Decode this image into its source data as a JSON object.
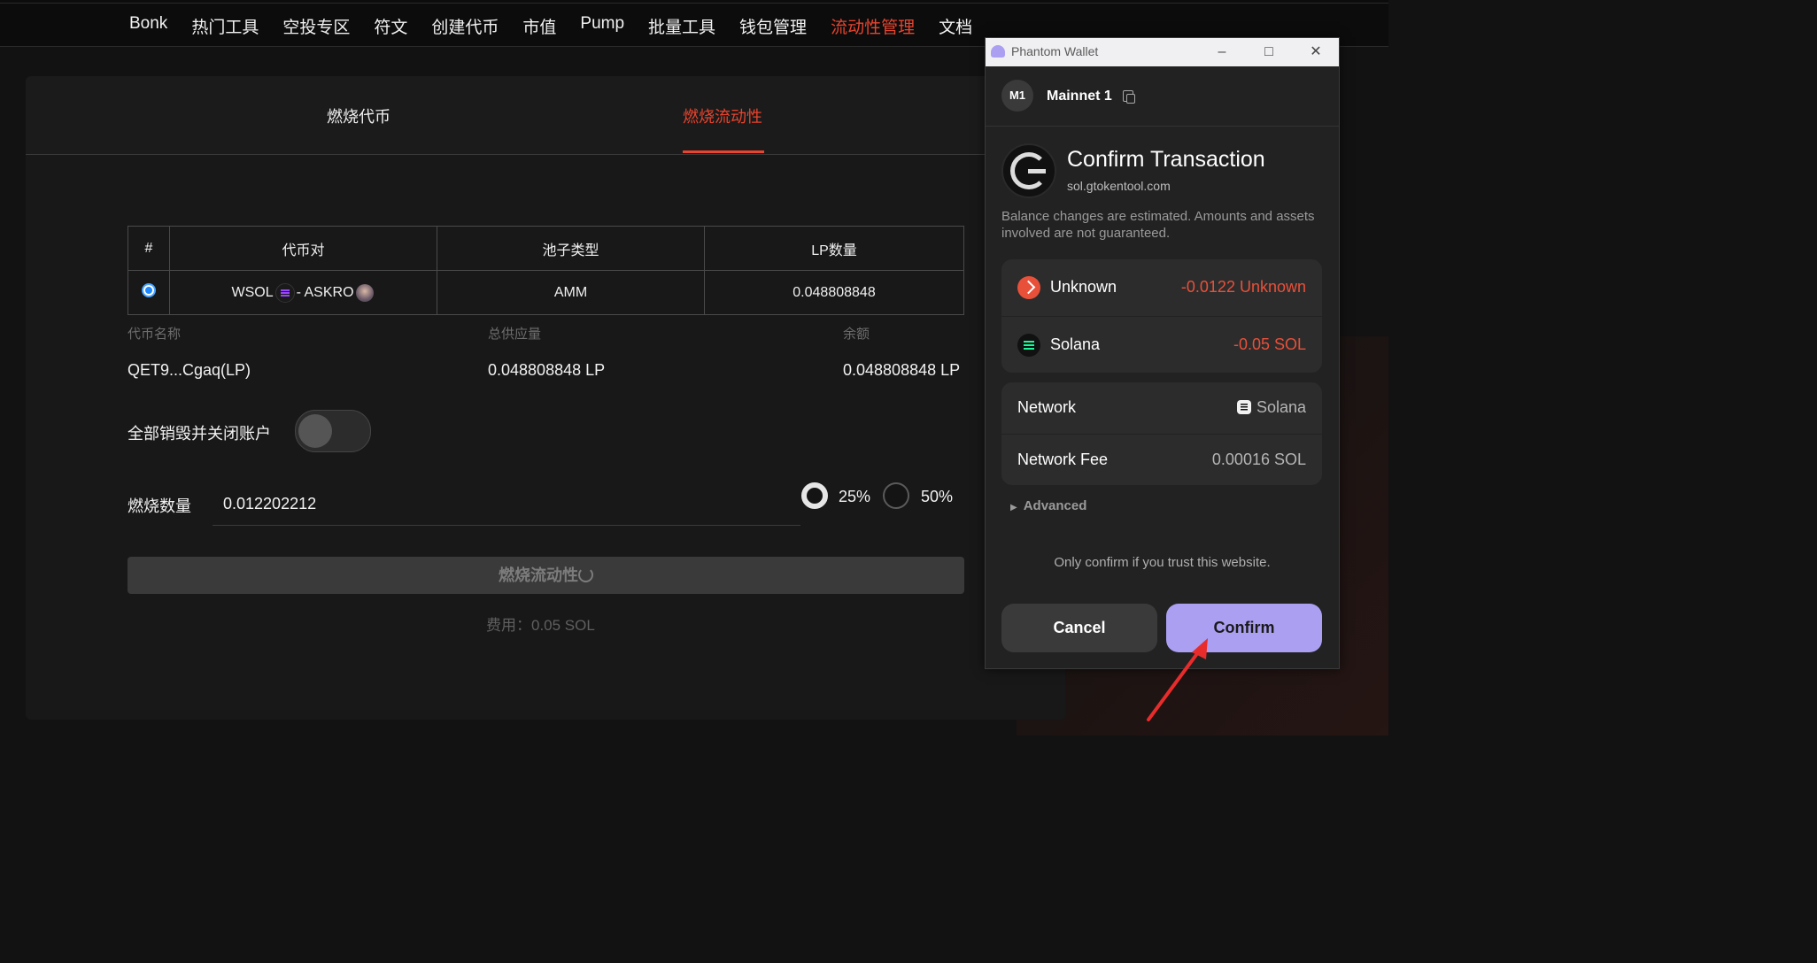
{
  "nav": {
    "items": [
      "Bonk",
      "热门工具",
      "空投专区",
      "符文",
      "创建代币",
      "市值",
      "Pump",
      "批量工具",
      "钱包管理",
      "流动性管理",
      "文档"
    ],
    "active_index": 9
  },
  "tabs": {
    "burn_token": "燃烧代币",
    "burn_liquidity": "燃烧流动性"
  },
  "pool_table": {
    "headers": [
      "#",
      "代币对",
      "池子类型",
      "LP数量"
    ],
    "row": {
      "pair_left": "WSOL",
      "pair_sep": "-",
      "pair_right": "ASKRO",
      "pool_type": "AMM",
      "lp_amount": "0.048808848"
    }
  },
  "token_info": {
    "name_label": "代币名称",
    "supply_label": "总供应量",
    "balance_label": "余额",
    "name_value": "QET9...Cgaq(LP)",
    "supply_value": "0.048808848 LP",
    "balance_value": "0.048808848 LP"
  },
  "close_all": {
    "label": "全部销毁并关闭账户",
    "enabled": false
  },
  "burn_amount": {
    "label": "燃烧数量",
    "value": "0.012202212"
  },
  "percent_options": [
    {
      "label": "25%",
      "selected": true
    },
    {
      "label": "50%",
      "selected": false
    }
  ],
  "burn_button": {
    "label": "燃烧流动性"
  },
  "fee_text": "费用：0.05 SOL",
  "popup": {
    "window_title": "Phantom Wallet",
    "account_badge": "M1",
    "account_name": "Mainnet 1",
    "title": "Confirm Transaction",
    "site": "sol.gtokentool.com",
    "warning": "Balance changes are estimated. Amounts and assets involved are not guaranteed.",
    "changes": [
      {
        "name": "Unknown",
        "amount": "-0.0122 Unknown",
        "icon": "unknown-token-icon"
      },
      {
        "name": "Solana",
        "amount": "-0.05 SOL",
        "icon": "solana-icon"
      }
    ],
    "network_label": "Network",
    "network_value": "Solana",
    "fee_label": "Network Fee",
    "fee_value": "0.00016 SOL",
    "advanced_label": "Advanced",
    "trust_text": "Only confirm if you trust this website.",
    "cancel_label": "Cancel",
    "confirm_label": "Confirm",
    "accent": "#ab9ff2",
    "negative_color": "#e8503a"
  }
}
